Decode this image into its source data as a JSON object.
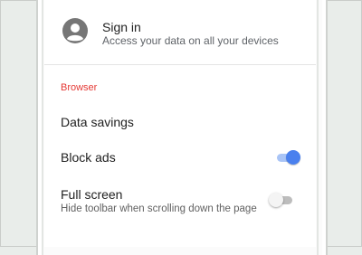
{
  "account": {
    "title": "Sign in",
    "subtitle": "Access your data on all your devices",
    "icon": "account-circle-icon"
  },
  "browser_section": {
    "header": "Browser",
    "header_color": "#e53935",
    "items": [
      {
        "label": "Data savings"
      },
      {
        "label": "Block ads",
        "toggle": true
      },
      {
        "label": "Full screen",
        "sublabel": "Hide toolbar when scrolling down the page",
        "toggle": false
      }
    ]
  },
  "colors": {
    "toggle_on": "#4a80ee",
    "toggle_off": "#f4f4f4"
  }
}
